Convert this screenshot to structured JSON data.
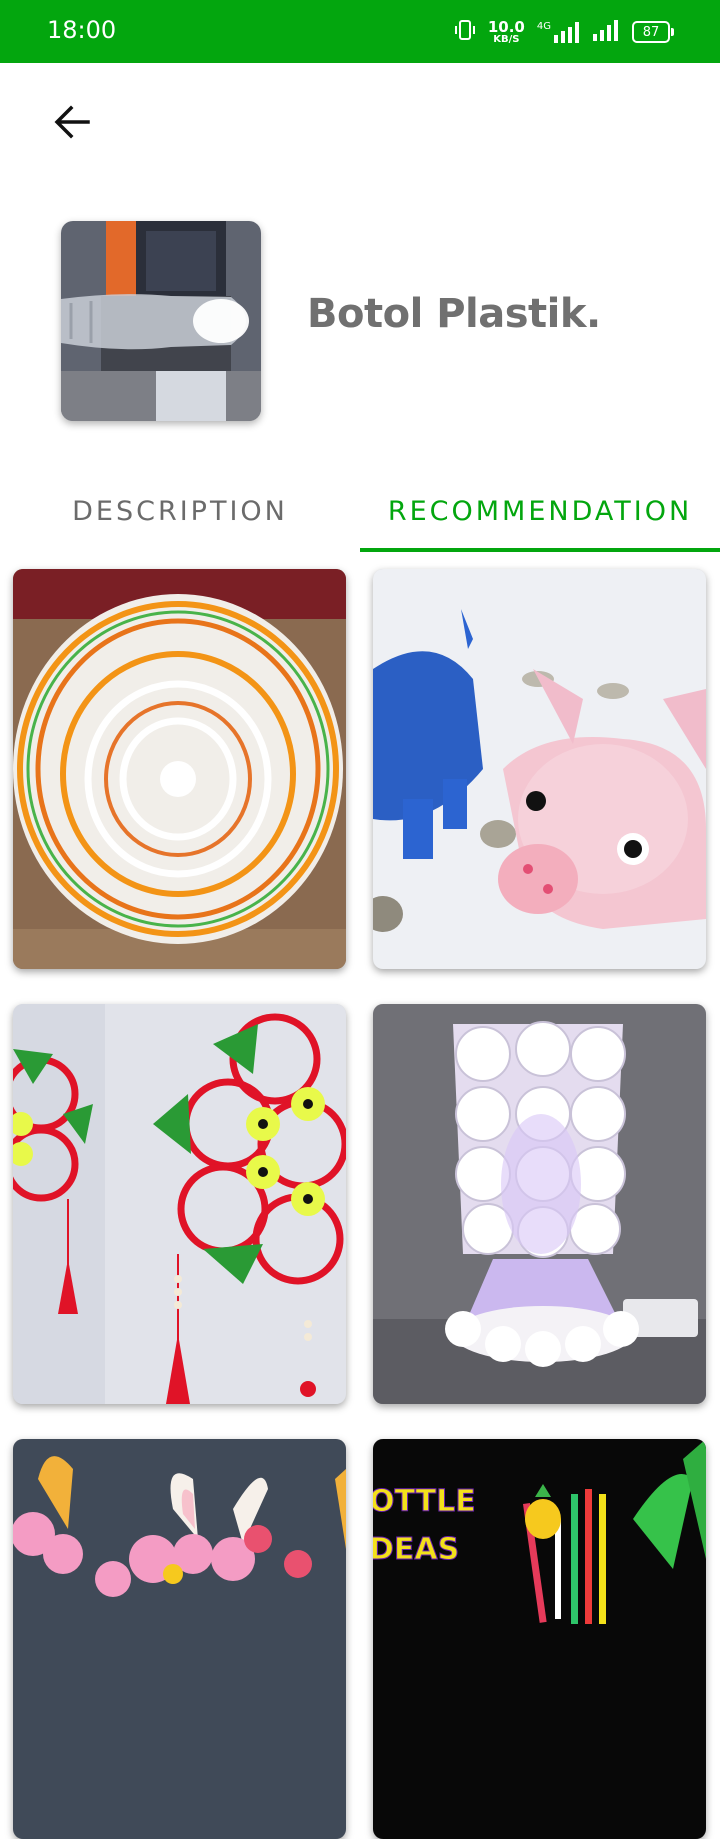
{
  "status_bar": {
    "time": "18:00",
    "net_speed_value": "10.0",
    "net_speed_unit": "KB/S",
    "network_type": "4G",
    "battery_level": "87",
    "icons": [
      "vibrate-icon",
      "signal-4g-icon",
      "signal-icon",
      "battery-icon"
    ]
  },
  "header": {
    "back_icon": "arrow-left-icon",
    "title": "Botol Plastik."
  },
  "tabs": [
    {
      "label": "DESCRIPTION",
      "selected": false
    },
    {
      "label": "RECOMMENDATION",
      "selected": true
    }
  ],
  "recommendations": [
    {
      "image": "woven-plastic-basket"
    },
    {
      "image": "plastic-bottle-piggy-banks"
    },
    {
      "image": "red-ring-wall-hanging"
    },
    {
      "image": "bottle-cap-lamp"
    },
    {
      "image": "bunny-flower-pots"
    },
    {
      "image": "bottle-ideas-pen-holder"
    }
  ],
  "bottle_ideas_text": [
    "OTTLE",
    "DEAS"
  ],
  "colors": {
    "accent": "#03a60e",
    "title_text": "#707070",
    "tab_inactive": "#6b6b6b"
  }
}
